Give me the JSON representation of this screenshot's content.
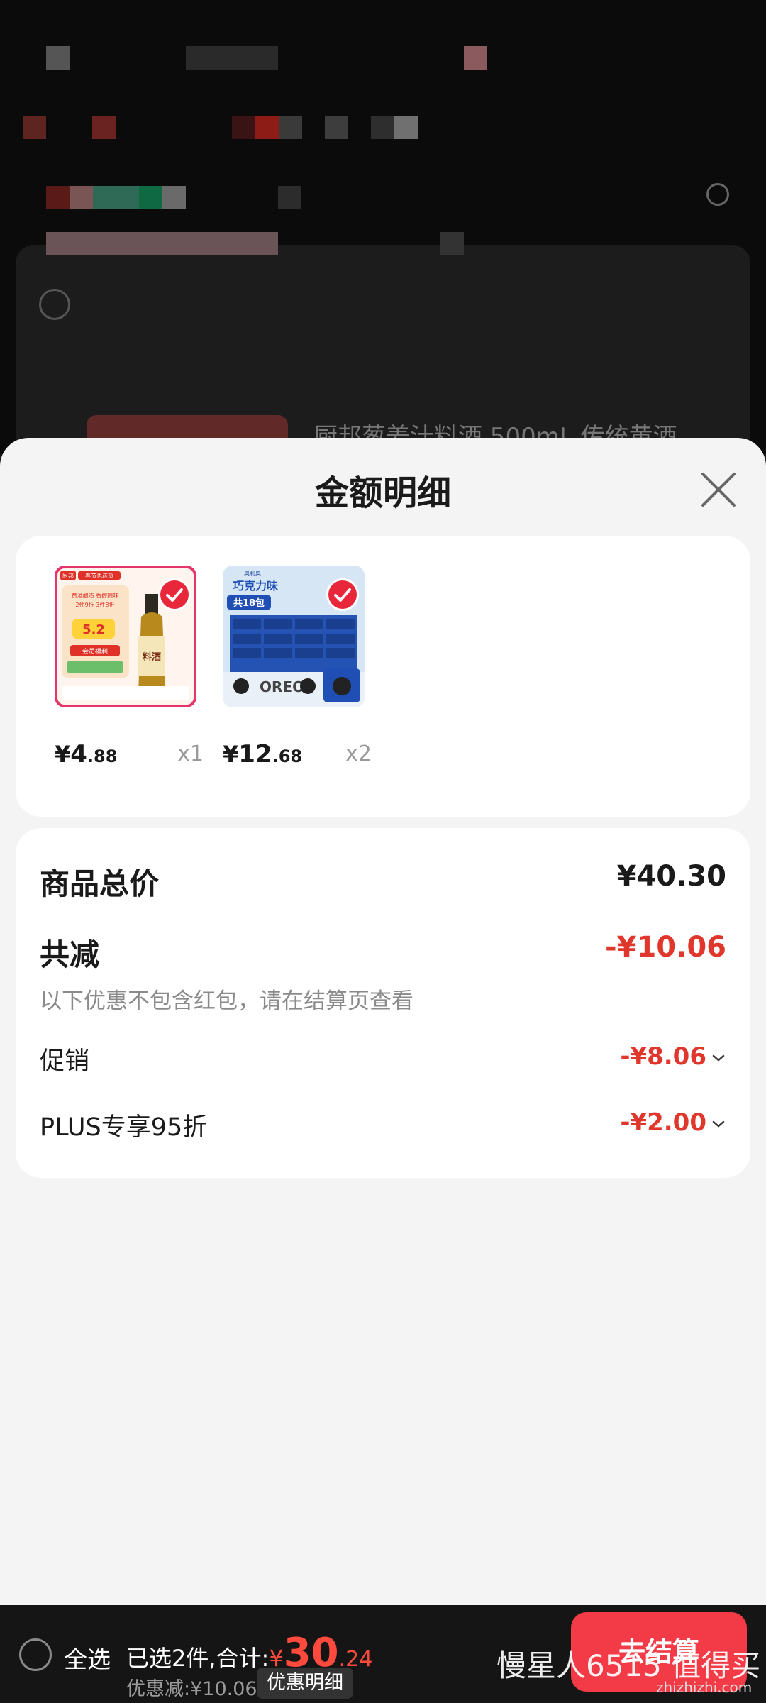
{
  "background": {
    "product_title": "厨邦葱姜汁料酒 500mL 传统黄酒"
  },
  "sheet": {
    "title": "金额明细"
  },
  "products": [
    {
      "currency": "¥",
      "price_int": "4",
      "price_dec": ".88",
      "qty": "x1"
    },
    {
      "currency": "¥",
      "price_int": "12",
      "price_dec": ".68",
      "qty": "x2"
    }
  ],
  "product_images": {
    "p1": {
      "brand": "厨邦",
      "banner": "春节也送货",
      "line1": "黄酒酿造 香醇提味",
      "line2": "2件9折 3件8折",
      "price_tag": "5.2",
      "sticker": "会员福利",
      "bottle_label": "料酒"
    },
    "p2": {
      "brand": "奥利奥",
      "flavor": "巧克力味",
      "pack_text": "共18包",
      "logo_letters": "OREO"
    }
  },
  "summary": {
    "total_label": "商品总价",
    "total_value": "¥40.30",
    "reduce_label": "共减",
    "reduce_value": "-¥10.06",
    "reduce_note": "以下优惠不包含红包，请在结算页查看",
    "promo_label": "促销",
    "promo_value": "-¥8.06",
    "plus_label": "PLUS专享95折",
    "plus_value": "-¥2.00"
  },
  "bottom_bar": {
    "select_all": "全选",
    "selected_text": "已选2件,合计:",
    "total_currency": "¥",
    "total_int": "30",
    "total_dec": ".24",
    "saved_text": "优惠减:¥10.06",
    "detail_button": "优惠明细",
    "checkout_button": "去结算",
    "watermark": "慢星人6515 值得买",
    "watermark_site": "zhizhizhi.com"
  },
  "colors": {
    "accent_red": "#e0372d",
    "checkout_red": "#f23b47",
    "sheet_bg": "#f4f4f4"
  }
}
